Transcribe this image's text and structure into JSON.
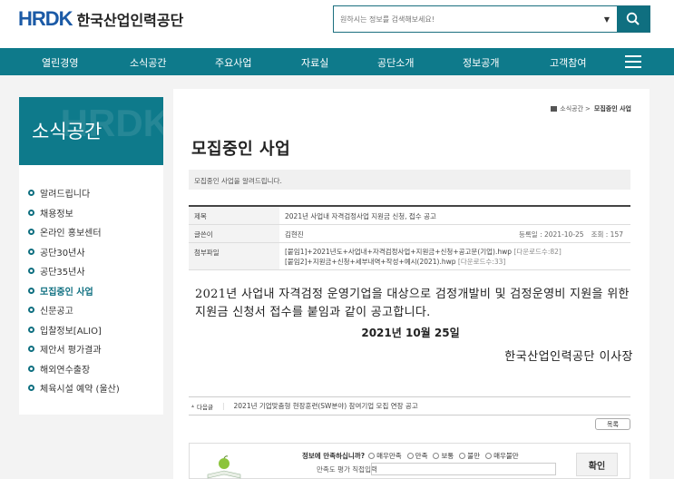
{
  "header": {
    "logo_mark": "HRDK",
    "logo_text": "한국산업인력공단",
    "search_placeholder": "원하시는 정보를 검색해보세요!"
  },
  "nav": {
    "items": [
      "열린경영",
      "소식공간",
      "주요사업",
      "자료실",
      "공단소개",
      "정보공개",
      "고객참여"
    ]
  },
  "sidebar": {
    "title": "소식공간",
    "watermark": "HRDK",
    "items": [
      {
        "label": "알려드립니다",
        "active": false
      },
      {
        "label": "채용정보",
        "active": false
      },
      {
        "label": "온라인 홍보센터",
        "active": false
      },
      {
        "label": "공단30년사",
        "active": false
      },
      {
        "label": "공단35년사",
        "active": false
      },
      {
        "label": "모집중인 사업",
        "active": true
      },
      {
        "label": "신문공고",
        "active": false
      },
      {
        "label": "입찰정보[ALIO]",
        "active": false
      },
      {
        "label": "제안서 평가결과",
        "active": false
      },
      {
        "label": "해외연수출장",
        "active": false
      },
      {
        "label": "체육시설 예약 (울산)",
        "active": false
      }
    ]
  },
  "breadcrumb": {
    "parent": "소식공간",
    "sep": ">",
    "current": "모집중인 사업"
  },
  "page": {
    "title": "모집중인 사업",
    "description": "모집중인 사업을 알려드립니다."
  },
  "post": {
    "title_label": "제목",
    "title": "2021년 사업내 자격검정사업 지원금 신청, 접수 공고",
    "author_label": "글쓴이",
    "author": "김현진",
    "reg_date": "등록일 : 2021-10-25",
    "views": "조회 : 157",
    "attach_label": "첨부파일",
    "attachments": [
      {
        "name": "[붙임1]+2021년도+사업내+자격검정사업+지원금+신청+공고문(기업).hwp",
        "downloads": "[다운로드수:82]"
      },
      {
        "name": "[붙임2]+지원금+신청+세부내역+작성+예시(2021).hwp",
        "downloads": "[다운로드수:33]"
      }
    ],
    "body": "2021년 사업내 자격검정 운영기업을 대상으로 검정개발비 및 검정운영비 지원을 위한 지원금 신청서 접수를 붙임과 같이 공고합니다.",
    "date": "2021년 10월 25일",
    "signature": "한국산업인력공단 이사장"
  },
  "next": {
    "label": "다음글",
    "sep": "|",
    "title": "2021년 기업맞춤형 현장훈련(SW분야) 참여기업 모집 연장 공고"
  },
  "list_button": "목록",
  "survey": {
    "question": "정보에 만족하십니까?",
    "options": [
      "매우만족",
      "만족",
      "보통",
      "불만",
      "매우불만"
    ],
    "field_label": "만족도 평가 직접입력",
    "submit": "확인"
  },
  "colors": {
    "brand": "#0e7a8b",
    "logo_blue": "#1b5aa6"
  }
}
